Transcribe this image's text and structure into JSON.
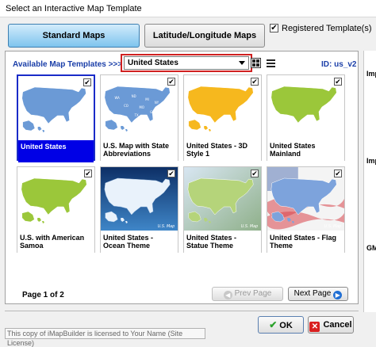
{
  "window": {
    "title": "Select an Interactive Map Template"
  },
  "tabs": [
    {
      "label": "Standard Maps",
      "active": true
    },
    {
      "label": "Latitude/Longitude Maps",
      "active": false
    }
  ],
  "registered": {
    "label": "Registered Template(s)",
    "checked": true,
    "mark": "✔"
  },
  "toolbar": {
    "available_label": "Available Map Templates >>>",
    "dropdown_value": "United States",
    "id_label": "ID: us_v2"
  },
  "templates": [
    {
      "line1": "United States",
      "line2": "",
      "checked": true,
      "selected": true,
      "style": "plain"
    },
    {
      "line1": "U.S. Map with State",
      "line2": "Abbreviations",
      "checked": true,
      "selected": false,
      "style": "abbr"
    },
    {
      "line1": "United States - 3D",
      "line2": "Style 1",
      "checked": true,
      "selected": false,
      "style": "orange"
    },
    {
      "line1": "United States",
      "line2": "Mainland",
      "checked": true,
      "selected": false,
      "style": "green"
    },
    {
      "line1": "U.S. with American",
      "line2": "Samoa",
      "checked": true,
      "selected": false,
      "style": "samoa"
    },
    {
      "line1": "United States -",
      "line2": "Ocean Theme",
      "checked": true,
      "selected": false,
      "style": "ocean"
    },
    {
      "line1": "United States -",
      "line2": "Statue Theme",
      "checked": true,
      "selected": false,
      "style": "statue"
    },
    {
      "line1": "United States - Flag",
      "line2": "Theme",
      "checked": true,
      "selected": false,
      "style": "flag"
    }
  ],
  "thumb_watermark": "U.S. Map",
  "pagination": {
    "page_label": "Page 1 of 2",
    "prev_label": "Prev Page",
    "next_label": "Next Page"
  },
  "right_strip": {
    "a": "Imp",
    "b": "Imp",
    "c": "GM"
  },
  "footer": {
    "license": "This copy of iMapBuilder is licensed to Your Name (Site License)",
    "ok_label": "OK",
    "cancel_label": "Cancel"
  },
  "colors": {
    "selected_caption": "#0000e6",
    "link_blue": "#1a3ea8",
    "highlight_red": "#d02020",
    "map_blue": "#6b9ad6",
    "map_orange": "#f6b81e",
    "map_green": "#9bc73a"
  }
}
